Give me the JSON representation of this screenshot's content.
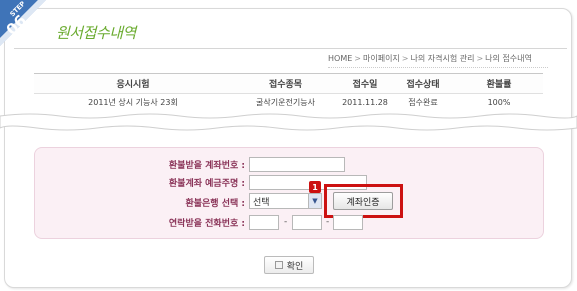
{
  "step": {
    "label": "STEP",
    "number": "06"
  },
  "page_title": "원서접수내역",
  "breadcrumb": [
    "HOME",
    "마이페이지",
    "나의 자격시험 관리",
    "나의 접수내역"
  ],
  "breadcrumb_sep": ">",
  "table": {
    "headers": [
      "응시시험",
      "접수종목",
      "접수일",
      "접수상태",
      "환불률"
    ],
    "rows": [
      [
        "2011년 상시 기능사 23회",
        "굴삭기운전기능사",
        "2011.11.28",
        "접수완료",
        "100%"
      ]
    ]
  },
  "form": {
    "account_label": "환불받을 계좌번호 :",
    "holder_label": "환불계좌 예금주명 :",
    "bank_label": "환불은행 선택 :",
    "phone_label": "연락받을 전화번호 :",
    "bank_select_value": "선택",
    "phone_dash": "-",
    "verify_button": "계좌인증",
    "step_marker": "1"
  },
  "confirm_button": "확인",
  "colors": {
    "step_badge": "#3f74b8",
    "title_green": "#6aab2f",
    "form_bg": "#fbf0f5",
    "label": "#8a3358",
    "highlight": "#cc1111"
  }
}
